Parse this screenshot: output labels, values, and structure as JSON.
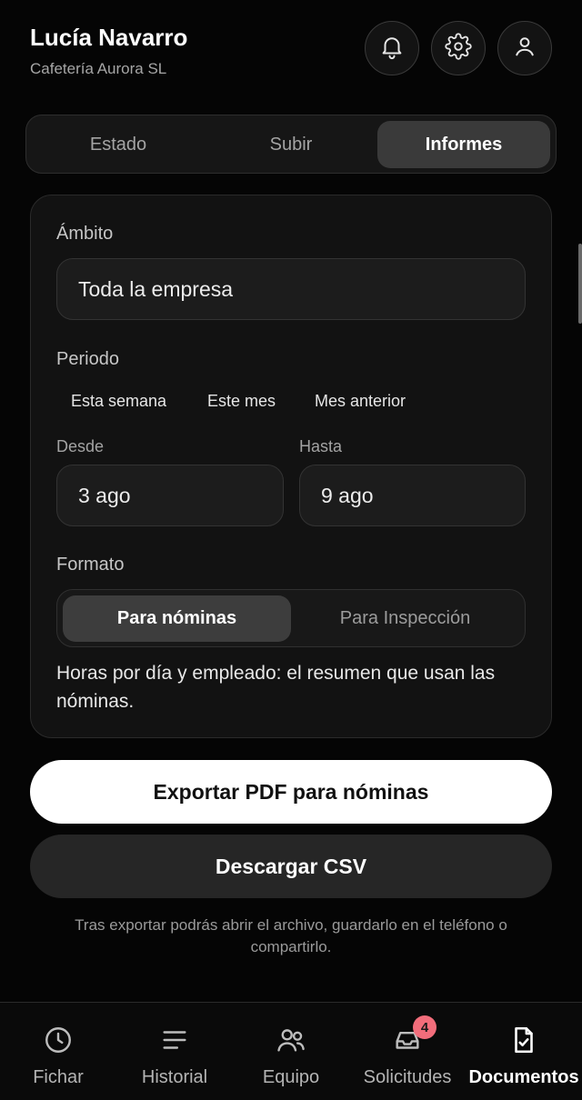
{
  "header": {
    "user_name": "Lucía Navarro",
    "company": "Cafetería Aurora SL",
    "icons": [
      "bell-icon",
      "gear-icon",
      "user-icon"
    ]
  },
  "tabs": [
    {
      "label": "Estado",
      "active": false
    },
    {
      "label": "Subir",
      "active": false
    },
    {
      "label": "Informes",
      "active": true
    }
  ],
  "report": {
    "scope_label": "Ámbito",
    "scope_value": "Toda la empresa",
    "period_label": "Periodo",
    "period_options": [
      "Esta semana",
      "Este mes",
      "Mes anterior"
    ],
    "from_label": "Desde",
    "from_value": "3 ago",
    "to_label": "Hasta",
    "to_value": "9 ago",
    "format_label": "Formato",
    "format_options": [
      {
        "label": "Para nóminas",
        "active": true
      },
      {
        "label": "Para Inspección",
        "active": false
      }
    ],
    "format_description": "Horas por día y empleado: el resumen que usan las nóminas."
  },
  "actions": {
    "export_pdf": "Exportar PDF para nóminas",
    "download_csv": "Descargar CSV",
    "hint": "Tras exportar podrás abrir el archivo, guardarlo en el teléfono o compartirlo."
  },
  "bottom_nav": [
    {
      "label": "Fichar",
      "icon": "clock-icon",
      "active": false
    },
    {
      "label": "Historial",
      "icon": "list-icon",
      "active": false
    },
    {
      "label": "Equipo",
      "icon": "team-icon",
      "active": false
    },
    {
      "label": "Solicitudes",
      "icon": "inbox-icon",
      "active": false,
      "badge": "4"
    },
    {
      "label": "Documentos",
      "icon": "document-check-icon",
      "active": true
    }
  ],
  "colors": {
    "background": "#050505",
    "primary_button": "#ffffff",
    "badge": "#f26d7b"
  }
}
